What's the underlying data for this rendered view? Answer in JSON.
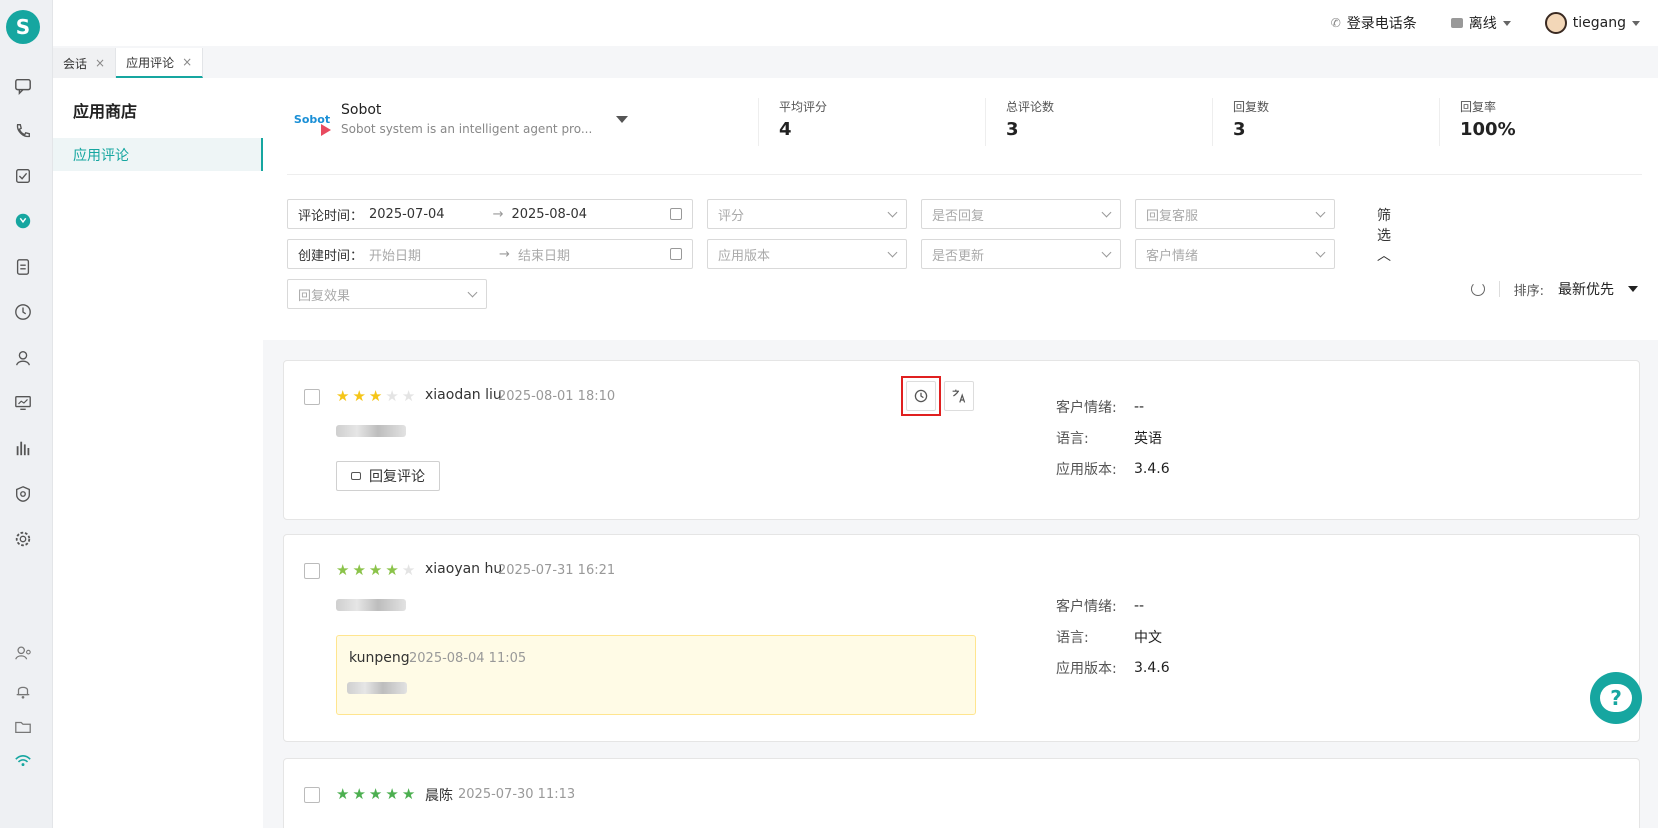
{
  "topbar": {
    "phone_label": "登录电话条",
    "status_label": "离线",
    "user_name": "tiegang"
  },
  "tabs": [
    {
      "label": "会话",
      "close": "×"
    },
    {
      "label": "应用评论",
      "close": "×"
    }
  ],
  "leftnav": {
    "title": "应用商店",
    "item": "应用评论"
  },
  "app": {
    "logo_text": "Sobot",
    "name": "Sobot",
    "desc": "Sobot system is an intelligent agent pro..."
  },
  "stats": [
    {
      "label": "平均评分",
      "value": "4"
    },
    {
      "label": "总评论数",
      "value": "3"
    },
    {
      "label": "回复数",
      "value": "3"
    },
    {
      "label": "回复率",
      "value": "100%"
    }
  ],
  "filters": {
    "review_time_label": "评论时间：",
    "review_start": "2025-07-04",
    "review_end": "2025-08-04",
    "arrow": "→",
    "create_time_label": "创建时间：",
    "create_start_placeholder": "开始日期",
    "create_end_placeholder": "结束日期",
    "rating": "评分",
    "replied": "是否回复",
    "reply_agent": "回复客服",
    "app_version": "应用版本",
    "updated": "是否更新",
    "sentiment": "客户情绪",
    "reply_effect": "回复效果",
    "toggle_label": "筛选 ︿"
  },
  "sort": {
    "label": "排序:",
    "value": "最新优先"
  },
  "meta_labels": {
    "sentiment": "客户情绪:",
    "language": "语言:",
    "version": "应用版本:"
  },
  "reviews": [
    {
      "name": "xiaodan liu",
      "time": "2025-08-01 18:10",
      "rating": 3,
      "star_color": "#f5c518",
      "sentiment": "--",
      "language": "英语",
      "version": "3.4.6",
      "reply_button": "回复评论"
    },
    {
      "name": "xiaoyan hu",
      "time": "2025-07-31 16:21",
      "rating": 4,
      "star_color": "#8bc34a",
      "sentiment": "--",
      "language": "中文",
      "version": "3.4.6",
      "reply_name": "kunpeng",
      "reply_time": "2025-08-04 11:05"
    },
    {
      "name": "晨陈",
      "time": "2025-07-30 11:13",
      "rating": 5,
      "star_color": "#4caf50"
    }
  ],
  "help_glyph": "?",
  "colors": {
    "accent": "#16a6a0",
    "highlight": "#e02020"
  }
}
